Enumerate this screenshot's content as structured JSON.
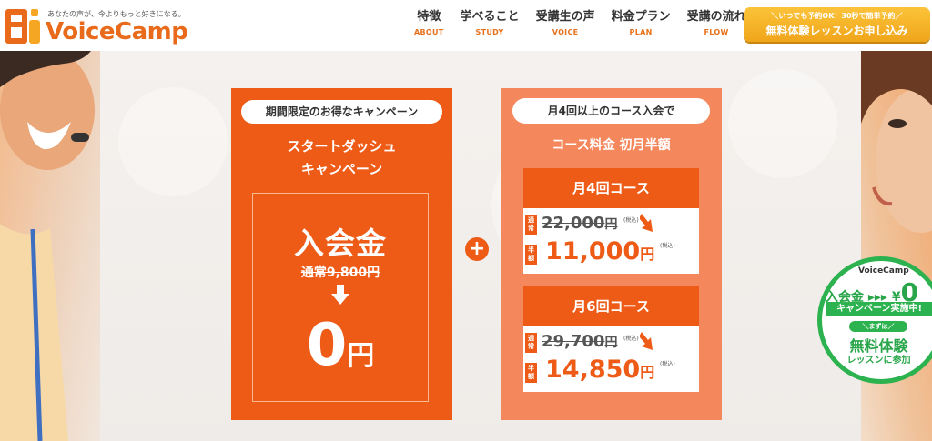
{
  "header": {
    "tagline": "あなたの声が、今よりもっと好きになる。",
    "logo_text": "VoiceCamp",
    "nav": [
      {
        "ja": "特徴",
        "en": "ABOUT"
      },
      {
        "ja": "学べること",
        "en": "STUDY"
      },
      {
        "ja": "受講生の声",
        "en": "VOICE"
      },
      {
        "ja": "料金プラン",
        "en": "PLAN"
      },
      {
        "ja": "受講の流れ",
        "en": "FLOW"
      }
    ],
    "cta": {
      "sub": "＼いつでも予約OK！30秒で簡単予約／",
      "main": "無料体験レッスンお申し込み"
    }
  },
  "campaign": {
    "badge": "期間限定のお得なキャンペーン",
    "title_line1": "スタートダッシュ",
    "title_line2": "キャンペーン",
    "fee_label": "入会金",
    "old_fee": "通常9,800円",
    "new_fee_number": "0",
    "new_fee_unit": "円"
  },
  "plus_symbol": "+",
  "course_offer": {
    "badge": "月4回以上のコース入会で",
    "subtitle": "コース料金 初月半額",
    "courses": [
      {
        "name": "月4回コース",
        "old_tag": "通常",
        "old_price": "22,000",
        "old_yen": "円",
        "tax": "(税込)",
        "new_tag": "半額",
        "new_price": "11,000",
        "new_yen": "円"
      },
      {
        "name": "月6回コース",
        "old_tag": "通常",
        "old_price": "29,700",
        "old_yen": "円",
        "tax": "(税込)",
        "new_tag": "半額",
        "new_price": "14,850",
        "new_yen": "円"
      }
    ]
  },
  "round_badge": {
    "logo": "VoiceCamp",
    "line1": "入会金 ▸▸▸ ¥",
    "zero": "0",
    "strip": "キャンペーン実施中!",
    "small": "＼まずは／",
    "big": "無料体験",
    "sub": "レッスンに参加"
  },
  "colors": {
    "brand_orange": "#ee5b17",
    "course_card": "#f5875c",
    "cta_yellow": "#f4b02a",
    "badge_green": "#2cb24e"
  }
}
